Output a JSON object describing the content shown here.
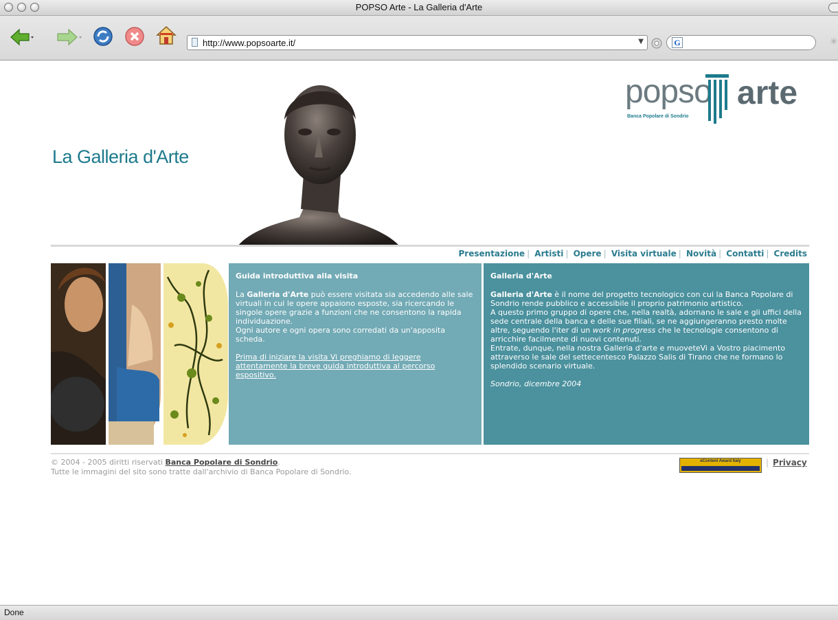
{
  "window": {
    "title": "POPSO Arte - La Galleria d'Arte"
  },
  "toolbar": {
    "url": "http://www.popsoarte.it/",
    "search_engine_icon": "G"
  },
  "status": {
    "text": "Done"
  },
  "site": {
    "title": "La Galleria d'Arte",
    "logo": {
      "word": "popso",
      "arte": "arte",
      "subtitle": "Banca Popolare di Sondrio"
    },
    "menu": [
      "Presentazione",
      "Artisti",
      "Opere",
      "Visita virtuale",
      "Novità",
      "Contatti",
      "Credits"
    ],
    "box_left": {
      "heading": "Guida introduttiva alla visita",
      "body_pre": "La ",
      "body_bold": "Galleria d'Arte",
      "body_post": " può essere visitata sia accedendo alle sale virtuali in cui le opere appaiono esposte, sia ricercando le singole opere grazie a funzioni che ne consentono la rapida individuazione.",
      "body_2": "Ogni autore e ogni opera sono corredati da un'apposita scheda.",
      "link": "Prima di iniziare la visita Vi preghiamo di leggere attentamente la breve guida introduttiva al percorso espositivo."
    },
    "box_right": {
      "heading": "Galleria d'Arte",
      "bold": "Galleria d'Arte",
      "p1": " è il nome del progetto tecnologico con cui la Banca Popolare di Sondrio rende pubblico e accessibile il proprio patrimonio artistico.",
      "p2_pre": "A questo primo gruppo di opere che, nella realtà, adornano le sale e gli uffici della sede centrale della banca e delle sue filiali, se ne aggiungeranno presto molte altre, seguendo l'iter di un ",
      "p2_italic": "work in progress",
      "p2_post": " che le tecnologie consentono di arricchire facilmente di nuovi contenuti.",
      "p3": "Entrate, dunque, nella nostra Galleria d'arte e muoveteVi a Vostro piacimento attraverso le sale del settecentesco Palazzo Salis di Tirano che ne formano lo splendido scenario virtuale.",
      "signoff": "Sondrio, dicembre 2004"
    },
    "footer": {
      "copyright_pre": "© 2004 - 2005 diritti riservati ",
      "copyright_link": "Banca Popolare di Sondrio",
      "copyright_post": ".",
      "line2": "Tutte le immagini del sito sono tratte dall'archivio di Banca Popolare di Sondrio.",
      "award": "eContent Award Italy",
      "privacy": "Privacy"
    }
  },
  "colors": {
    "accent": "#1d7a8c",
    "box_left": "#72aab5",
    "box_right": "#4b919e"
  }
}
